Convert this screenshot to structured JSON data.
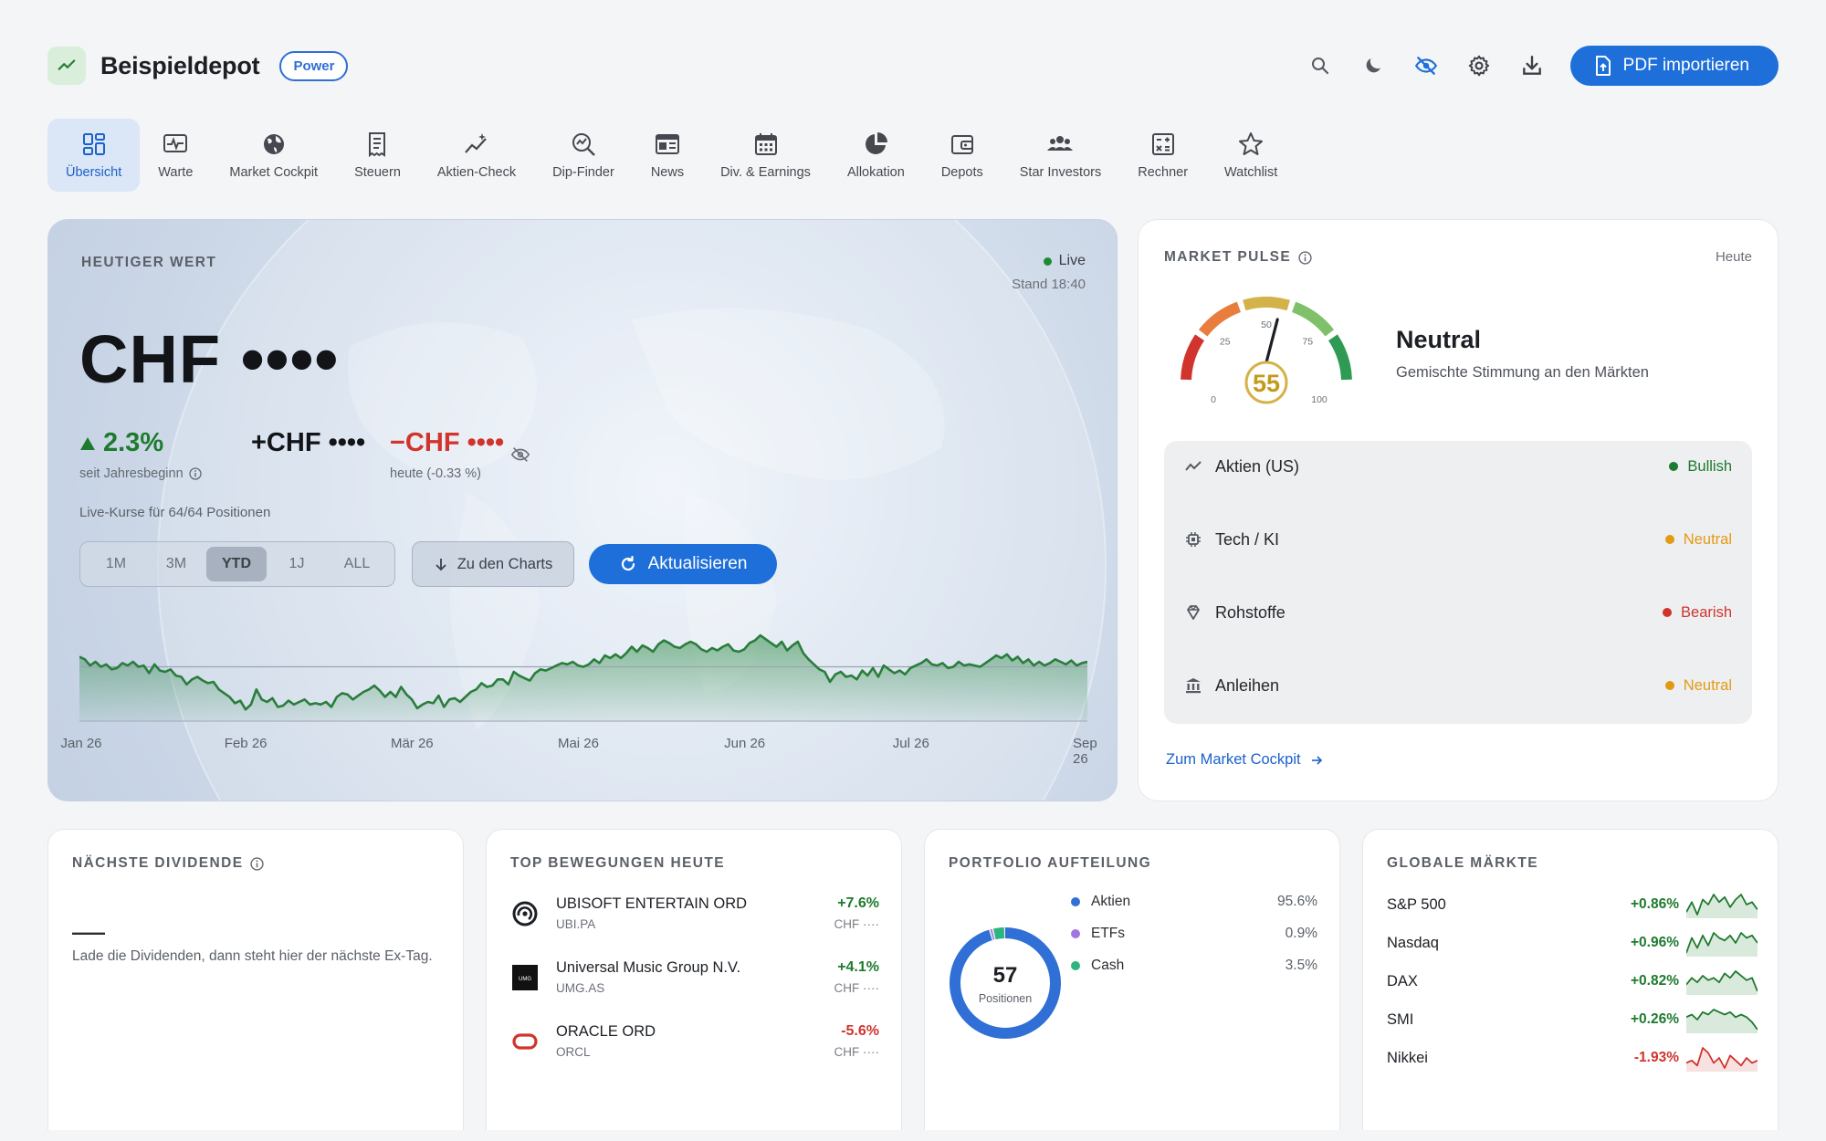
{
  "header": {
    "title": "Beispieldepot",
    "plan_badge": "Power",
    "import_button": "PDF importieren",
    "actions": [
      "search-icon",
      "moon-icon",
      "eye-off-icon",
      "gear-icon",
      "download-icon"
    ]
  },
  "nav": [
    {
      "label": "Übersicht",
      "icon": "dashboard-icon",
      "active": true
    },
    {
      "label": "Warte",
      "icon": "pulse-monitor-icon"
    },
    {
      "label": "Market Cockpit",
      "icon": "globe-icon"
    },
    {
      "label": "Steuern",
      "icon": "receipt-icon"
    },
    {
      "label": "Aktien-Check",
      "icon": "sparkle-chart-icon"
    },
    {
      "label": "Dip-Finder",
      "icon": "search-chart-icon"
    },
    {
      "label": "News",
      "icon": "newspaper-icon"
    },
    {
      "label": "Div. & Earnings",
      "icon": "calendar-icon"
    },
    {
      "label": "Allokation",
      "icon": "pie-icon"
    },
    {
      "label": "Depots",
      "icon": "wallet-icon"
    },
    {
      "label": "Star Investors",
      "icon": "people-icon"
    },
    {
      "label": "Rechner",
      "icon": "calculator-icon"
    },
    {
      "label": "Watchlist",
      "icon": "star-icon"
    }
  ],
  "hero": {
    "label": "HEUTIGER WERT",
    "live": "Live",
    "stand": "Stand 18:40",
    "value": "CHF ••••",
    "ytd_change": "2.3%",
    "ytd_sub": "seit Jahresbeginn",
    "abs_change": "+CHF ••••",
    "today_change": "−CHF ••••",
    "today_sub": "heute (-0.33 %)",
    "live_note": "Live-Kurse für 64/64 Positionen",
    "ranges": [
      "1M",
      "3M",
      "YTD",
      "1J",
      "ALL"
    ],
    "active_range": "YTD",
    "charts_button": "Zu den Charts",
    "refresh_button": "Aktualisieren",
    "x_ticks": [
      "Jan 26",
      "Feb 26",
      "Mär 26",
      "Mai 26",
      "Jun 26",
      "Jul 26",
      "Sep 26"
    ],
    "series": [
      62,
      60,
      55,
      58,
      54,
      56,
      52,
      53,
      57,
      55,
      58,
      54,
      55,
      49,
      56,
      51,
      50,
      52,
      47,
      46,
      40,
      44,
      46,
      43,
      41,
      42,
      36,
      33,
      30,
      25,
      27,
      20,
      24,
      36,
      28,
      26,
      29,
      22,
      23,
      27,
      24,
      26,
      28,
      24,
      25,
      24,
      26,
      22,
      30,
      33,
      32,
      28,
      31,
      34,
      36,
      39,
      35,
      30,
      34,
      30,
      38,
      32,
      28,
      21,
      24,
      26,
      25,
      31,
      22,
      28,
      29,
      26,
      30,
      34,
      36,
      41,
      38,
      39,
      44,
      44,
      40,
      50,
      47,
      45,
      43,
      49,
      52,
      51,
      53,
      55,
      57,
      56,
      58,
      55,
      54,
      56,
      60,
      57,
      63,
      61,
      64,
      61,
      65,
      70,
      66,
      71,
      69,
      66,
      72,
      75,
      73,
      70,
      69,
      72,
      74,
      72,
      68,
      66,
      69,
      67,
      70,
      72,
      67,
      66,
      68,
      73,
      75,
      79,
      76,
      73,
      70,
      74,
      67,
      71,
      74,
      65,
      60,
      56,
      52,
      50,
      42,
      48,
      50,
      46,
      47,
      44,
      51,
      47,
      53,
      46,
      55,
      52,
      49,
      51,
      48,
      53,
      55,
      57,
      60,
      56,
      55,
      57,
      53,
      54,
      58,
      55,
      56,
      55,
      54,
      57,
      60,
      63,
      61,
      64,
      59,
      62,
      57,
      60,
      55,
      58,
      55,
      57,
      60,
      58,
      56,
      59,
      55,
      57,
      58
    ],
    "baseline": 54
  },
  "market_pulse": {
    "label": "MARKET PULSE",
    "period": "Heute",
    "score": 55,
    "gauge_ticks": [
      "0",
      "25",
      "50",
      "75",
      "100"
    ],
    "sentiment": "Neutral",
    "sentiment_sub": "Gemischte Stimmung an den Märkten",
    "sectors": [
      {
        "name": "Aktien (US)",
        "status": "Bullish",
        "color": "#1e7a2e",
        "icon": "trend-icon"
      },
      {
        "name": "Tech / KI",
        "status": "Neutral",
        "color": "#e29a12",
        "icon": "chip-icon"
      },
      {
        "name": "Rohstoffe",
        "status": "Bearish",
        "color": "#d0342c",
        "icon": "diamond-icon"
      },
      {
        "name": "Anleihen",
        "status": "Neutral",
        "color": "#e29a12",
        "icon": "bank-icon"
      }
    ],
    "link": "Zum Market Cockpit"
  },
  "dividend": {
    "label": "NÄCHSTE DIVIDENDE",
    "value": "—",
    "text": "Lade die Dividenden, dann steht hier der nächste Ex-Tag."
  },
  "movers": {
    "label": "TOP BEWEGUNGEN HEUTE",
    "items": [
      {
        "name": "UBISOFT ENTERTAIN ORD",
        "ticker": "UBI.PA",
        "change": "+7.6%",
        "cur": "CHF ····",
        "positive": true,
        "logo": "ubisoft-logo"
      },
      {
        "name": "Universal Music Group N.V.",
        "ticker": "UMG.AS",
        "change": "+4.1%",
        "cur": "CHF ····",
        "positive": true,
        "logo": "umg-logo"
      },
      {
        "name": "ORACLE ORD",
        "ticker": "ORCL",
        "change": "-5.6%",
        "cur": "CHF ····",
        "positive": false,
        "logo": "oracle-logo"
      }
    ]
  },
  "allocation": {
    "label": "PORTFOLIO AUFTEILUNG",
    "positions": "57",
    "positions_label": "Positionen",
    "items": [
      {
        "name": "Aktien",
        "pct": "95.6%",
        "value": 95.6,
        "color": "#2f6fd6"
      },
      {
        "name": "ETFs",
        "pct": "0.9%",
        "value": 0.9,
        "color": "#a077e0"
      },
      {
        "name": "Cash",
        "pct": "3.5%",
        "value": 3.5,
        "color": "#2cb57e"
      }
    ]
  },
  "markets": {
    "label": "GLOBALE MÄRKTE",
    "items": [
      {
        "name": "S&P 500",
        "change": "+0.86%",
        "positive": true,
        "spark": [
          5,
          9,
          4,
          10,
          8,
          12,
          9,
          11,
          7,
          10,
          12,
          8,
          9,
          6
        ]
      },
      {
        "name": "Nasdaq",
        "change": "+0.96%",
        "positive": true,
        "spark": [
          4,
          10,
          6,
          11,
          7,
          12,
          10,
          9,
          11,
          8,
          12,
          10,
          11,
          8
        ]
      },
      {
        "name": "DAX",
        "change": "+0.82%",
        "positive": true,
        "spark": [
          6,
          9,
          7,
          10,
          8,
          9,
          7,
          11,
          9,
          12,
          10,
          8,
          9,
          3
        ]
      },
      {
        "name": "SMI",
        "change": "+0.26%",
        "positive": true,
        "spark": [
          8,
          9,
          7,
          10,
          9,
          11,
          10,
          9,
          10,
          8,
          9,
          8,
          6,
          3
        ]
      },
      {
        "name": "Nikkei",
        "change": "-1.93%",
        "positive": false,
        "spark": [
          5,
          6,
          4,
          11,
          9,
          5,
          7,
          3,
          8,
          6,
          4,
          7,
          5,
          6
        ]
      }
    ]
  },
  "colors": {
    "accent": "#1e6fd9",
    "positive": "#1e7a2e",
    "negative": "#d0342c",
    "neutral": "#e29a12"
  }
}
